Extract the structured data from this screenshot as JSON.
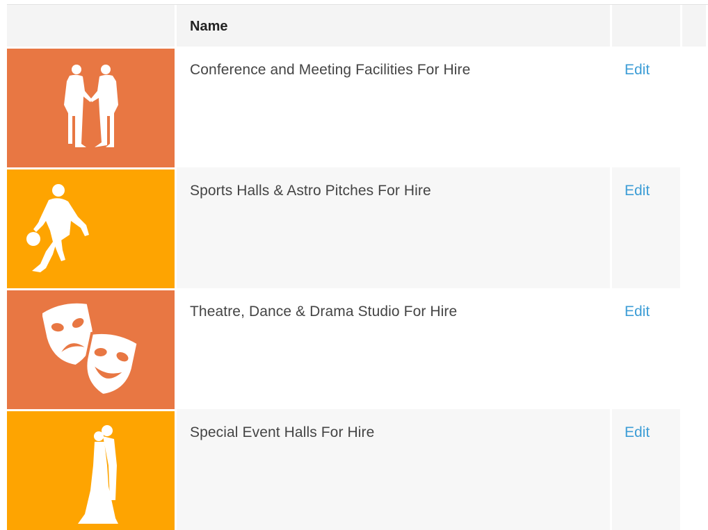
{
  "table": {
    "columns": {
      "image": "",
      "name": "Name",
      "actions": "",
      "extra": ""
    },
    "rows": [
      {
        "name": "Conference and Meeting Facilities For Hire",
        "action": "Edit",
        "image": "handshake-silhouette-icon",
        "color": "#e87743"
      },
      {
        "name": "Sports Halls & Astro Pitches For Hire",
        "action": "Edit",
        "image": "basketball-player-silhouette-icon",
        "color": "#fea401"
      },
      {
        "name": "Theatre, Dance & Drama Studio For Hire",
        "action": "Edit",
        "image": "theatre-masks-icon",
        "color": "#e87743"
      },
      {
        "name": "Special Event Halls For Hire",
        "action": "Edit",
        "image": "wedding-couple-silhouette-icon",
        "color": "#fea401"
      }
    ]
  }
}
